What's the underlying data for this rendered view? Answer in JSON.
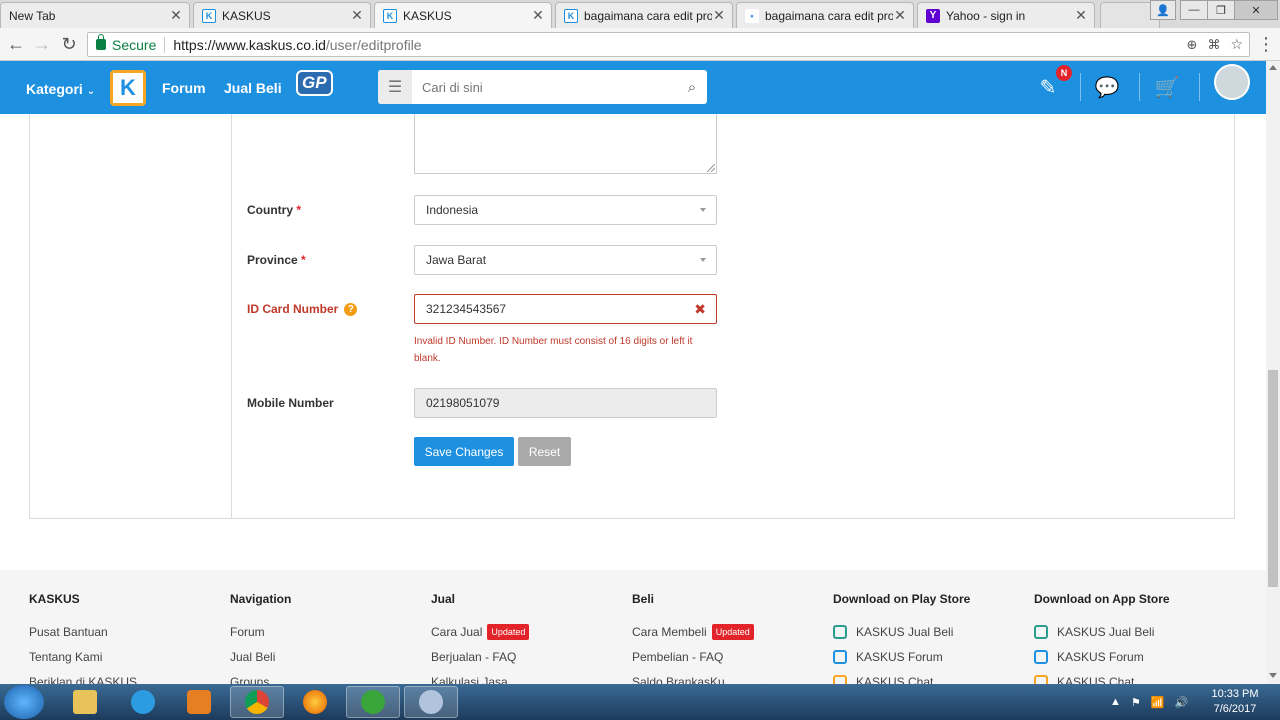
{
  "browser": {
    "tabs": [
      {
        "title": "New Tab",
        "favicon": "none"
      },
      {
        "title": "KASKUS",
        "favicon": "kaskus"
      },
      {
        "title": "KASKUS",
        "favicon": "kaskus"
      },
      {
        "title": "bagaimana cara edit profile",
        "favicon": "kaskus"
      },
      {
        "title": "bagaimana cara edit profile",
        "favicon": "google"
      },
      {
        "title": "Yahoo - sign in",
        "favicon": "yahoo"
      }
    ],
    "active_tab": 2,
    "secure_label": "Secure",
    "url_host": "https://www.kaskus.co.id",
    "url_path": "/user/editprofile"
  },
  "header": {
    "kategori": "Kategori",
    "logo": "K",
    "forum": "Forum",
    "jual_beli": "Jual Beli",
    "gp_mania": "GP",
    "search_placeholder": "Cari di sini",
    "notif_badge": "N",
    "brand_color": "#1e90e0"
  },
  "form": {
    "country": {
      "label": "Country",
      "required": "*",
      "value": "Indonesia"
    },
    "province": {
      "label": "Province",
      "required": "*",
      "value": "Jawa Barat"
    },
    "id_card": {
      "label": "ID Card Number",
      "help": "?",
      "value": "321234543567",
      "error": "Invalid ID Number. ID Number must consist of 16 digits or left it blank."
    },
    "mobile": {
      "label": "Mobile Number",
      "value": "02198051079"
    },
    "save_label": "Save Changes",
    "reset_label": "Reset"
  },
  "footer": {
    "columns": [
      {
        "title": "KASKUS",
        "items": [
          "Pusat Bantuan",
          "Tentang Kami",
          "Beriklan di KASKUS"
        ]
      },
      {
        "title": "Navigation",
        "items": [
          "Forum",
          "Jual Beli",
          "Groups"
        ]
      },
      {
        "title": "Jual",
        "items": [
          "Cara Jual",
          "Berjualan - FAQ",
          "Kalkulasi Jasa"
        ],
        "badge_index": 0
      },
      {
        "title": "Beli",
        "items": [
          "Cara Membeli",
          "Pembelian - FAQ",
          "Saldo BrankasKu"
        ],
        "badge_index": 0
      },
      {
        "title": "Download on Play Store",
        "items": [
          "KASKUS Jual Beli",
          "KASKUS Forum",
          "KASKUS Chat"
        ]
      },
      {
        "title": "Download on App Store",
        "items": [
          "KASKUS Jual Beli",
          "KASKUS Forum",
          "KASKUS Chat"
        ]
      }
    ],
    "badge": "Updated"
  },
  "taskbar": {
    "time": "10:33 PM",
    "date": "7/6/2017"
  }
}
